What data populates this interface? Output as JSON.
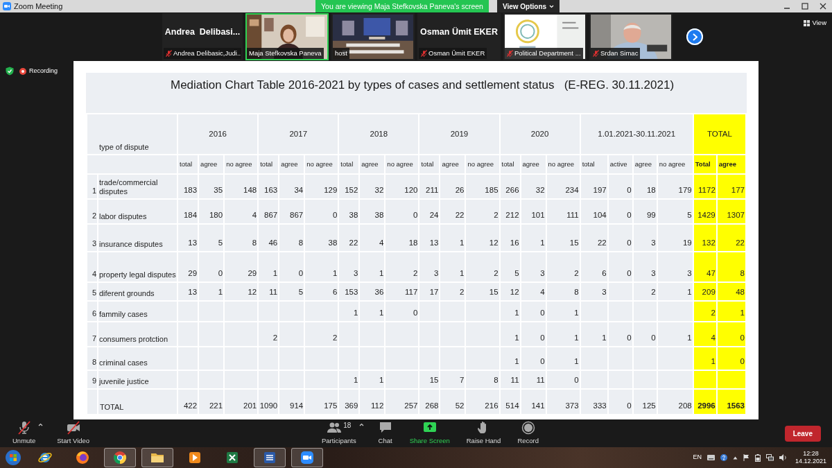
{
  "window": {
    "title": "Zoom Meeting"
  },
  "banner": {
    "text": "You are viewing Maja Stefkovska Paneva's screen",
    "view_options": "View Options"
  },
  "participants_strip": [
    {
      "kind": "name",
      "display": "Andrea  Delibasi...",
      "label": "Andrea Delibasic,Judi...",
      "muted": true,
      "selected": false
    },
    {
      "kind": "video",
      "label": "Maja Stefkovska Paneva",
      "muted": false,
      "selected": true
    },
    {
      "kind": "video",
      "label": "host",
      "muted": false,
      "selected": false
    },
    {
      "kind": "name",
      "display": "Osman Ümit EKER",
      "label": "Osman Ümit EKER",
      "muted": true,
      "selected": false
    },
    {
      "kind": "video",
      "label": "Political Department ...",
      "muted": true,
      "selected": false
    },
    {
      "kind": "video",
      "label": "Srdan Simac",
      "muted": true,
      "selected": false
    }
  ],
  "view_button": "View",
  "recording": "Recording",
  "slide": {
    "title": "Mediation Chart Table 2016-2021 by types of cases and settlement status   (E-REG. 30.11.2021)",
    "row_label_header": "type of dispute",
    "groups": [
      {
        "label": "2016",
        "columns": [
          "total",
          "agree",
          "no agree"
        ],
        "highlight": false
      },
      {
        "label": "2017",
        "columns": [
          "total",
          "agree",
          "no agree"
        ],
        "highlight": false
      },
      {
        "label": "2018",
        "columns": [
          "total",
          "agree",
          "no agree"
        ],
        "highlight": false
      },
      {
        "label": "2019",
        "columns": [
          "total",
          "agree",
          "no agree"
        ],
        "highlight": false
      },
      {
        "label": "2020",
        "columns": [
          "total",
          "agree",
          "no agree"
        ],
        "highlight": false
      },
      {
        "label": "1.01.2021-30.11.2021",
        "columns": [
          "total",
          "active",
          "agree",
          "no agree"
        ],
        "highlight": false
      },
      {
        "label": "TOTAL",
        "columns": [
          "Total",
          "agree"
        ],
        "highlight": true
      }
    ],
    "rows": [
      {
        "number": "1",
        "type": "trade/commercial disputes",
        "kind": "item",
        "cells": [
          "183",
          "35",
          "148",
          "163",
          "34",
          "129",
          "152",
          "32",
          "120",
          "211",
          "26",
          "185",
          "266",
          "32",
          "234",
          "197",
          "0",
          "18",
          "179",
          "1172",
          "177"
        ]
      },
      {
        "number": "2",
        "type": "labor disputes",
        "kind": "item",
        "cells": [
          "184",
          "180",
          "4",
          "867",
          "867",
          "0",
          "38",
          "38",
          "0",
          "24",
          "22",
          "2",
          "212",
          "101",
          "111",
          "104",
          "0",
          "99",
          "5",
          "1429",
          "1307"
        ]
      },
      {
        "number": "3",
        "type": "insurance disputes",
        "kind": "item",
        "cells": [
          "13",
          "5",
          "8",
          "46",
          "8",
          "38",
          "22",
          "4",
          "18",
          "13",
          "1",
          "12",
          "16",
          "1",
          "15",
          "22",
          "0",
          "3",
          "19",
          "132",
          "22"
        ]
      },
      {
        "number": "4",
        "type": "property legal disputes",
        "kind": "item",
        "cells": [
          "29",
          "0",
          "29",
          "1",
          "0",
          "1",
          "3",
          "1",
          "2",
          "3",
          "1",
          "2",
          "5",
          "3",
          "2",
          "6",
          "0",
          "3",
          "3",
          "47",
          "8"
        ]
      },
      {
        "number": "5",
        "type": "diferent grounds",
        "kind": "item",
        "cells": [
          "13",
          "1",
          "12",
          "11",
          "5",
          "6",
          "153",
          "36",
          "117",
          "17",
          "2",
          "15",
          "12",
          "4",
          "8",
          "3",
          null,
          "2",
          "1",
          "209",
          "48"
        ]
      },
      {
        "number": "6",
        "type": "fammily cases",
        "kind": "item",
        "cells": [
          null,
          null,
          null,
          null,
          null,
          null,
          "1",
          "1",
          "0",
          null,
          null,
          null,
          "1",
          "0",
          "1",
          null,
          null,
          null,
          null,
          "2",
          "1"
        ]
      },
      {
        "number": "7",
        "type": "consumers protction",
        "kind": "item",
        "cells": [
          null,
          null,
          null,
          "2",
          null,
          "2",
          null,
          null,
          null,
          null,
          null,
          null,
          "1",
          "0",
          "1",
          "1",
          "0",
          "0",
          "1",
          "4",
          "0"
        ]
      },
      {
        "number": "8",
        "type": "criminal cases",
        "kind": "item",
        "cells": [
          null,
          null,
          null,
          null,
          null,
          null,
          null,
          null,
          null,
          null,
          null,
          null,
          "1",
          "0",
          "1",
          null,
          null,
          null,
          null,
          "1",
          "0"
        ]
      },
      {
        "number": "9",
        "type": "juvenile justice",
        "kind": "item",
        "cells": [
          null,
          null,
          null,
          null,
          null,
          null,
          "1",
          "1",
          null,
          "15",
          "7",
          "8",
          "11",
          "11",
          "0",
          null,
          null,
          null,
          null,
          null,
          null
        ]
      },
      {
        "number": null,
        "type": "TOTAL",
        "kind": "total",
        "cells": [
          "422",
          "221",
          "201",
          "1090",
          "914",
          "175",
          "369",
          "112",
          "257",
          "268",
          "52",
          "216",
          "514",
          "141",
          "373",
          "333",
          "0",
          "125",
          "208",
          "2996",
          "1563"
        ]
      }
    ]
  },
  "toolbar_left": [
    {
      "kind": "mic",
      "label": "Unmute",
      "slashed": true,
      "has_menu": true
    },
    {
      "kind": "video",
      "label": "Start Video",
      "slashed": true,
      "has_menu": false
    }
  ],
  "toolbar_center": [
    {
      "kind": "participants",
      "label": "Participants",
      "count": "18",
      "has_menu": true
    },
    {
      "kind": "chat",
      "label": "Chat",
      "has_menu": false
    },
    {
      "kind": "share",
      "label": "Share Screen",
      "has_menu": false
    },
    {
      "kind": "hand",
      "label": "Raise Hand",
      "has_menu": false
    },
    {
      "kind": "record",
      "label": "Record",
      "has_menu": false
    }
  ],
  "leave_button": "Leave",
  "taskbar": {
    "apps": [
      {
        "kind": "ie",
        "running": false
      },
      {
        "kind": "firefox",
        "running": false
      },
      {
        "kind": "chrome",
        "running": true
      },
      {
        "kind": "folder",
        "running": true
      },
      {
        "kind": "media",
        "running": false
      },
      {
        "kind": "excel",
        "running": false
      },
      {
        "kind": "word",
        "running": true
      },
      {
        "kind": "zoom",
        "running": true
      }
    ],
    "language": "EN",
    "time": "12:28",
    "date": "14.12.2021"
  }
}
